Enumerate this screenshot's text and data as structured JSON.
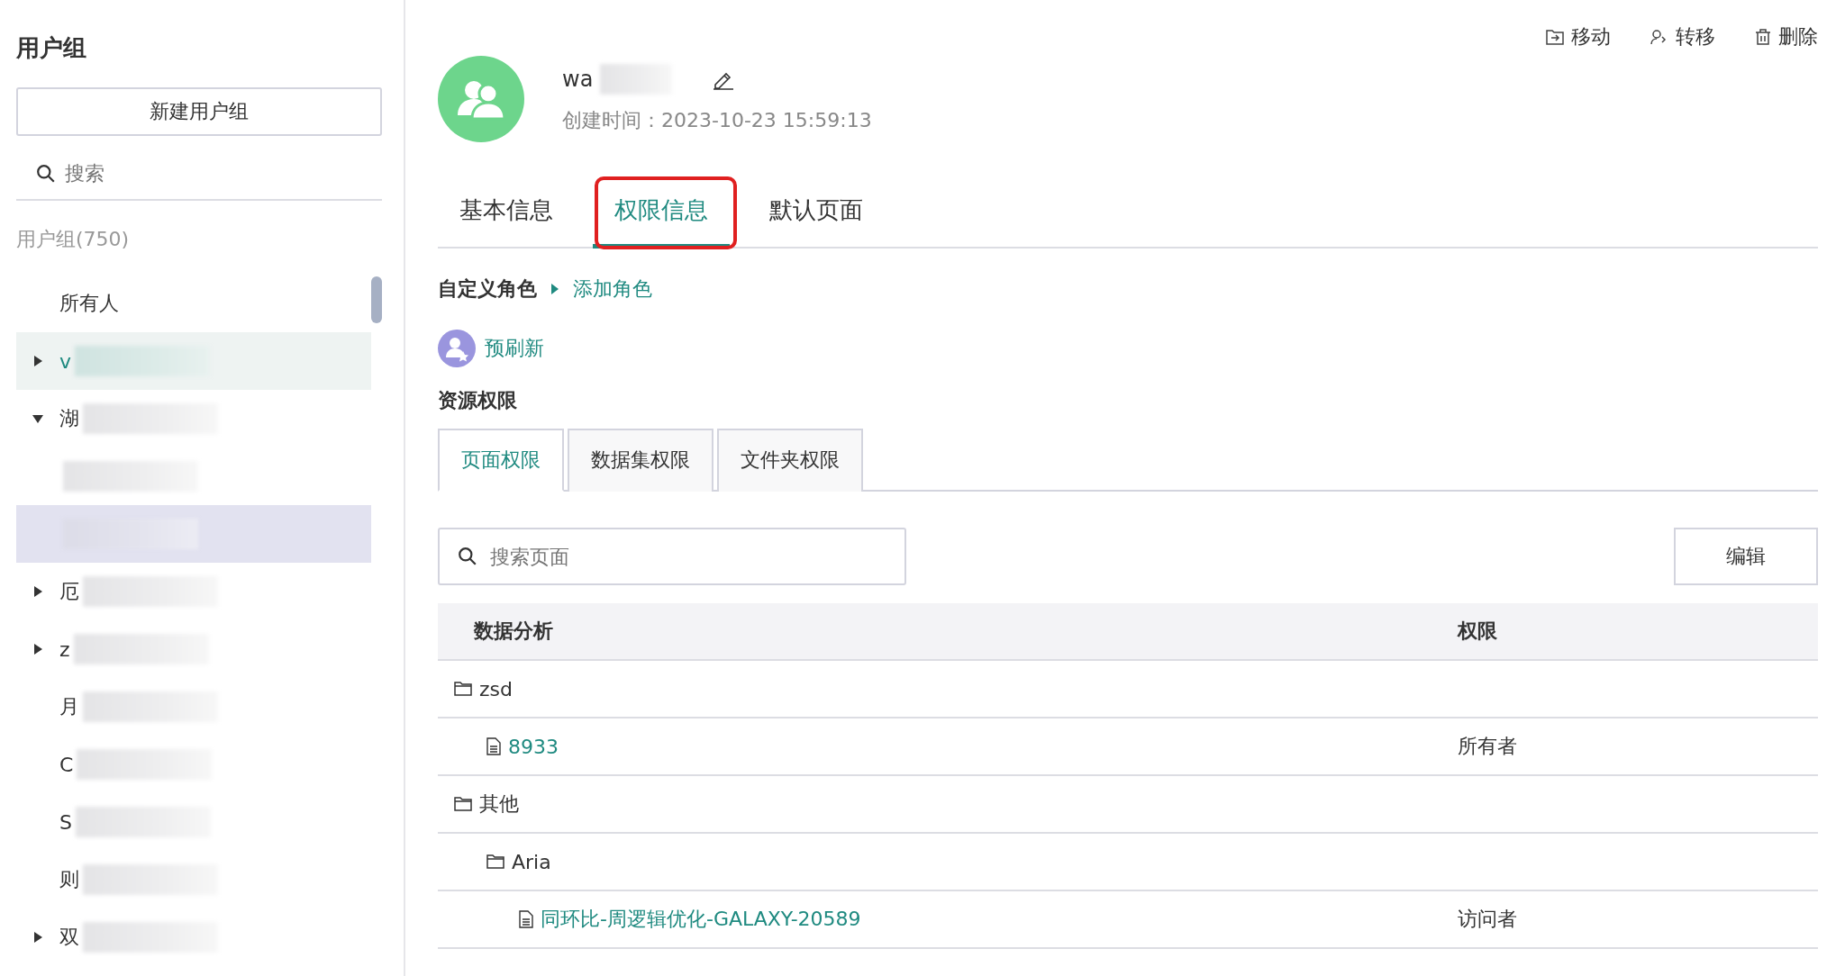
{
  "sidebar": {
    "title": "用户组",
    "new_button": "新建用户组",
    "search": {
      "placeholder": "搜索"
    },
    "count_label": "用户组(750)",
    "items": [
      {
        "kind": "named",
        "label": "所有人",
        "expandable": false,
        "selected": false,
        "hovered": false
      },
      {
        "kind": "redacted",
        "label": "v",
        "expandable": true,
        "expanded": false,
        "selected": true,
        "hovered": false
      },
      {
        "kind": "redacted",
        "label": "湖",
        "expandable": true,
        "expanded": true,
        "selected": false,
        "hovered": false
      },
      {
        "kind": "redacted",
        "expandable": false,
        "selected": false,
        "hovered": false
      },
      {
        "kind": "redacted",
        "expandable": false,
        "selected": false,
        "hovered": true
      },
      {
        "kind": "redacted",
        "label": "厄",
        "expandable": true,
        "expanded": false,
        "selected": false,
        "hovered": false
      },
      {
        "kind": "redacted",
        "label": "z",
        "expandable": true,
        "expanded": false,
        "selected": false,
        "hovered": false
      },
      {
        "kind": "redacted",
        "label": "月",
        "expandable": false,
        "selected": false,
        "hovered": false
      },
      {
        "kind": "redacted",
        "label": "C",
        "expandable": false,
        "selected": false,
        "hovered": false
      },
      {
        "kind": "redacted",
        "label": "S",
        "expandable": false,
        "selected": false,
        "hovered": false
      },
      {
        "kind": "redacted",
        "label": "则",
        "expandable": false,
        "selected": false,
        "hovered": false
      },
      {
        "kind": "redacted",
        "label": "双",
        "expandable": true,
        "expanded": false,
        "selected": false,
        "hovered": false
      }
    ]
  },
  "actions": [
    {
      "kind": "move",
      "label": "移动"
    },
    {
      "kind": "transfer",
      "label": "转移"
    },
    {
      "kind": "delete",
      "label": "删除"
    }
  ],
  "group": {
    "name": "wa",
    "created": "创建时间：2023-10-23 15:59:13"
  },
  "tabs": [
    {
      "label": "基本信息",
      "selected": false,
      "callout": false
    },
    {
      "label": "权限信息",
      "selected": true,
      "callout": true
    },
    {
      "label": "默认页面",
      "selected": false,
      "callout": false
    }
  ],
  "custom_role": {
    "label": "自定义角色",
    "add_link": "添加角色"
  },
  "role": {
    "label": "预刷新"
  },
  "resource": {
    "title": "资源权限",
    "subtabs": [
      {
        "label": "页面权限",
        "selected": true
      },
      {
        "label": "数据集权限",
        "selected": false
      },
      {
        "label": "文件夹权限",
        "selected": false
      }
    ],
    "search": {
      "placeholder": "搜索页面"
    },
    "edit_button": "编辑",
    "columns": [
      "数据分析",
      "权限"
    ],
    "rows": [
      {
        "kind": "folder",
        "name": "zsd",
        "children": [
          {
            "kind": "page",
            "name": "8933",
            "permission": "所有者"
          }
        ]
      },
      {
        "kind": "folder",
        "name": "其他",
        "children": [
          {
            "kind": "folder",
            "name": "Aria",
            "children": [
              {
                "kind": "page",
                "name": "同环比-周逻辑优化-GALAXY-20589",
                "permission": "访问者"
              }
            ]
          }
        ]
      }
    ]
  }
}
